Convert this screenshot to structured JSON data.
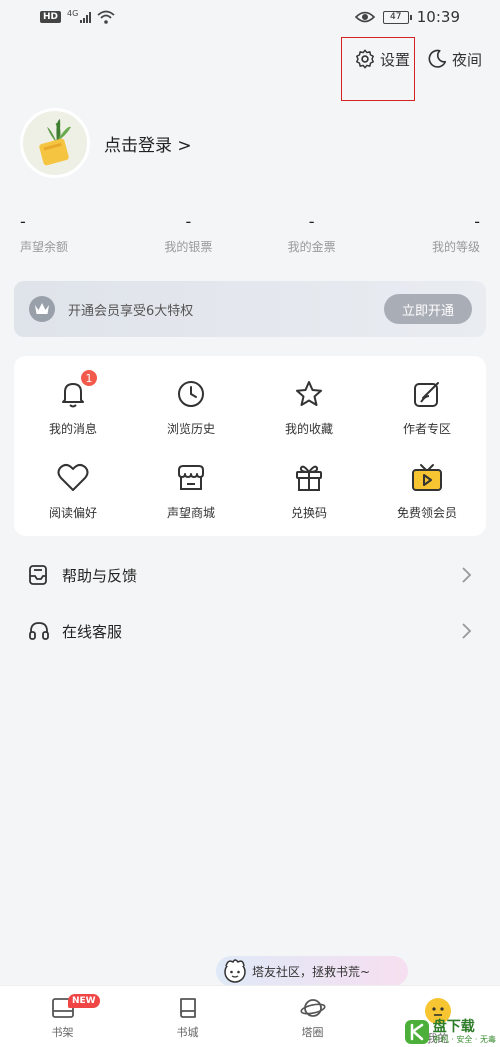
{
  "status_bar": {
    "hd": "HD",
    "signal_label": "4G",
    "battery": "47",
    "time": "10:39"
  },
  "top_actions": {
    "settings_label": "设置",
    "night_label": "夜间"
  },
  "profile": {
    "login_label": "点击登录 >"
  },
  "stats": [
    {
      "value": "-",
      "label": "声望余额"
    },
    {
      "value": "-",
      "label": "我的银票"
    },
    {
      "value": "-",
      "label": "我的金票"
    },
    {
      "value": "-",
      "label": "我的等级"
    }
  ],
  "vip": {
    "text": "开通会员享受6大特权",
    "button": "立即开通"
  },
  "grid": [
    {
      "label": "我的消息",
      "icon": "bell-icon",
      "badge": "1"
    },
    {
      "label": "浏览历史",
      "icon": "clock-icon"
    },
    {
      "label": "我的收藏",
      "icon": "star-icon"
    },
    {
      "label": "作者专区",
      "icon": "edit-icon"
    },
    {
      "label": "阅读偏好",
      "icon": "heart-icon"
    },
    {
      "label": "声望商城",
      "icon": "shop-icon"
    },
    {
      "label": "兑换码",
      "icon": "gift-icon"
    },
    {
      "label": "免费领会员",
      "icon": "tv-play-icon"
    }
  ],
  "list": [
    {
      "label": "帮助与反馈",
      "icon": "feedback-icon"
    },
    {
      "label": "在线客服",
      "icon": "headset-icon"
    }
  ],
  "bubble": {
    "text": "塔友社区，拯救书荒~"
  },
  "tabs": [
    {
      "label": "书架",
      "badge": "NEW"
    },
    {
      "label": "书城"
    },
    {
      "label": "塔圈"
    },
    {
      "label": "我的"
    }
  ],
  "watermark": {
    "title": "盘下载",
    "sub": "手机 · 安全 · 无毒"
  }
}
